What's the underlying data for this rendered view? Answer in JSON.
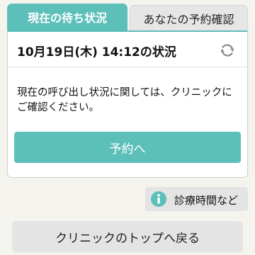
{
  "tabs": {
    "active_label": "現在の待ち状況",
    "inactive_label": "あなたの予約確認"
  },
  "status": {
    "datetime_label": "10月19日(木) 14:12の状況",
    "refresh_icon": "refresh-icon"
  },
  "message": {
    "text": "現在の呼び出し状況に関しては、クリニックにご確認ください。"
  },
  "buttons": {
    "reserve_label": "予約へ",
    "hours_label": "診療時間など",
    "hours_icon": "info-icon",
    "back_label": "クリニックのトップへ戻る"
  },
  "colors": {
    "accent": "#5dbfba",
    "background": "#f5f3ee",
    "button_gray": "#e4e4e4"
  }
}
